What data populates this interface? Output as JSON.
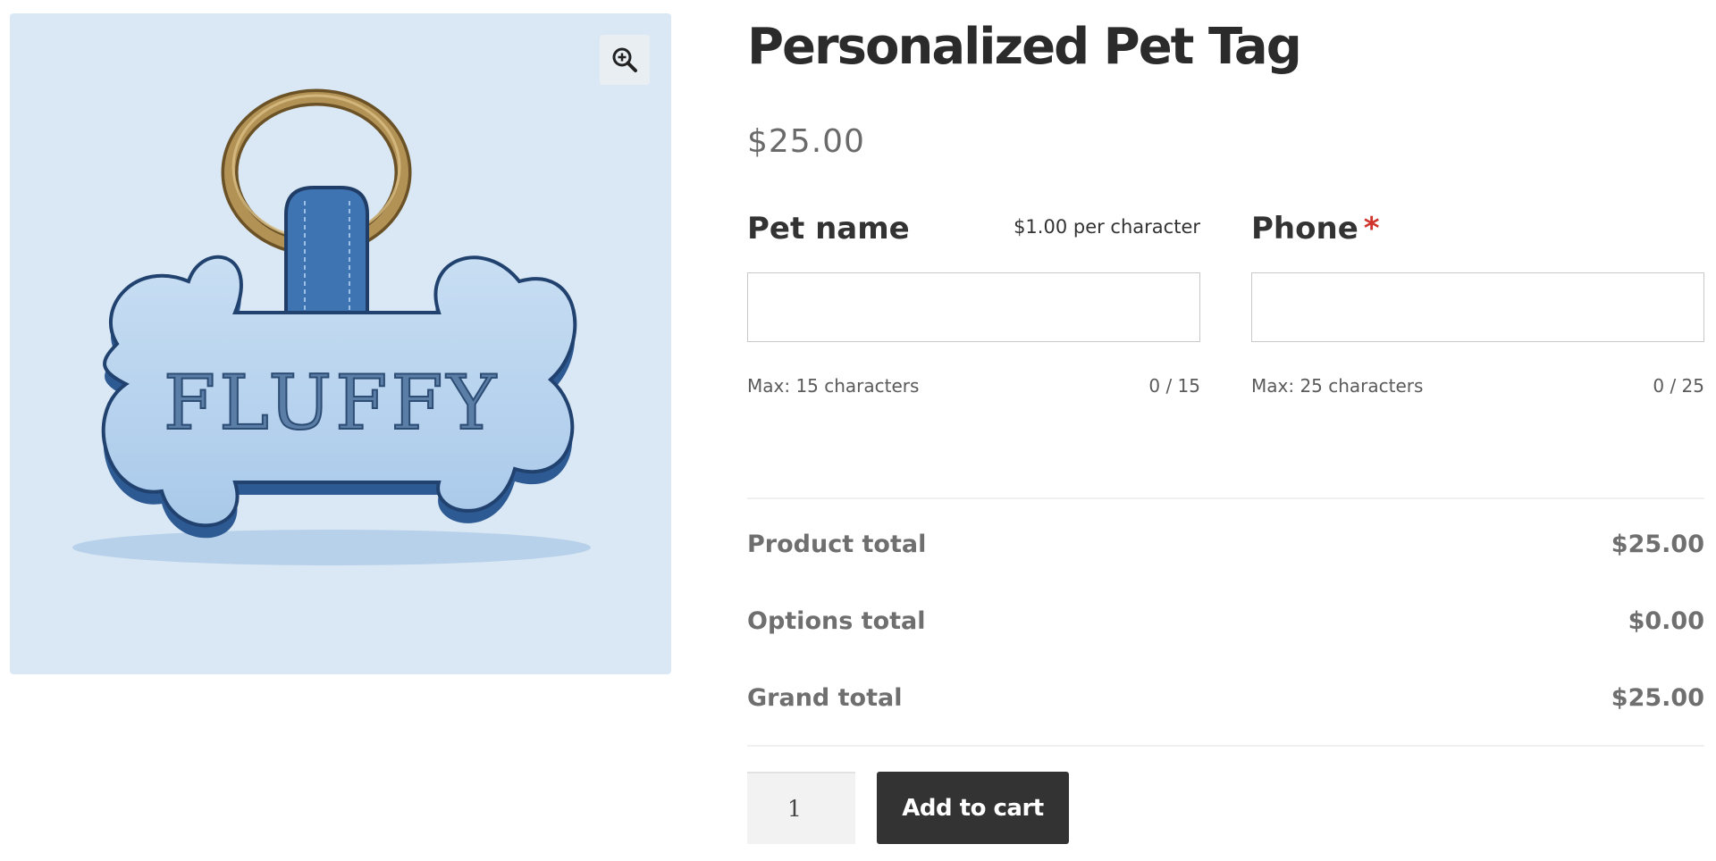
{
  "gallery": {
    "tag_engraving": "FLUFFY",
    "zoom_icon": "zoom-in-icon"
  },
  "product": {
    "title": "Personalized Pet Tag",
    "price": "$25.00"
  },
  "fields": {
    "pet_name": {
      "label": "Pet name",
      "price_amount": "$1.00",
      "price_unit": "per character",
      "value": "",
      "max_text": "Max: 15 characters",
      "counter": "0 / 15"
    },
    "phone": {
      "label": "Phone",
      "required_mark": "*",
      "value": "",
      "max_text": "Max: 25 characters",
      "counter": "0 / 25"
    }
  },
  "totals": {
    "product_total": {
      "label": "Product total",
      "value": "$25.00"
    },
    "options_total": {
      "label": "Options total",
      "value": "$0.00"
    },
    "grand_total": {
      "label": "Grand total",
      "value": "$25.00"
    }
  },
  "cart": {
    "quantity": "1",
    "add_to_cart_label": "Add to cart"
  },
  "colors": {
    "button_bg": "#333333",
    "required": "#d0342c",
    "image_bg": "#d9e8f4"
  }
}
